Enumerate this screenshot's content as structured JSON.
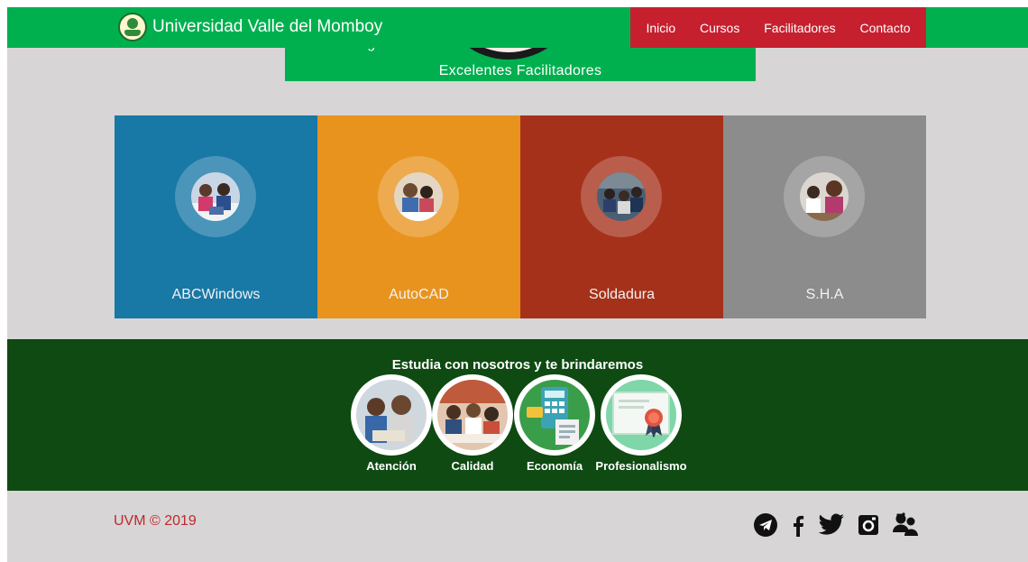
{
  "header": {
    "brand": "Universidad Valle del Momboy",
    "nav": [
      "Inicio",
      "Cursos",
      "Facilitadores",
      "Contacto"
    ],
    "hero_cut_text": "Vanguardia",
    "hero_subtitle": "Excelentes  Facilitadores"
  },
  "colors": {
    "green": "#00b04f",
    "red": "#c6202f",
    "dark_green": "#0e4a12",
    "page_bg": "#d7d5d6"
  },
  "courses": [
    {
      "label": "ABCWindows",
      "color": "#1878a6"
    },
    {
      "label": "AutoCAD",
      "color": "#e8931e"
    },
    {
      "label": "Soldadura",
      "color": "#a6311a"
    },
    {
      "label": "S.H.A",
      "color": "#8c8c8c"
    }
  ],
  "benefits": {
    "heading": "Estudia con nosotros y te brindaremos",
    "items": [
      "Atención",
      "Calidad",
      "Economía",
      "Profesionalismo"
    ]
  },
  "footer": {
    "copyright": "UVM © 2019",
    "social_icons": [
      "telegram-icon",
      "facebook-icon",
      "twitter-icon",
      "instagram-icon",
      "users-icon"
    ]
  }
}
